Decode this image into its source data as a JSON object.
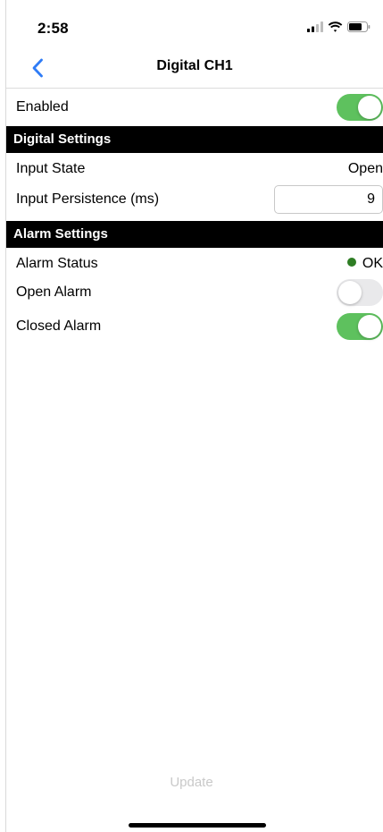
{
  "status_bar": {
    "time": "2:58",
    "icons": [
      "cellular-signal-icon",
      "wifi-icon",
      "battery-icon"
    ]
  },
  "nav": {
    "back_icon": "chevron-left-icon",
    "title": "Digital CH1"
  },
  "enabled_row": {
    "label": "Enabled",
    "toggle_on": true
  },
  "digital_settings": {
    "header": "Digital Settings",
    "input_state_label": "Input State",
    "input_state_value": "Open",
    "persistence_label": "Input Persistence (ms)",
    "persistence_value": "9"
  },
  "alarm_settings": {
    "header": "Alarm Settings",
    "alarm_status_label": "Alarm Status",
    "alarm_status_value": "OK",
    "open_alarm_label": "Open Alarm",
    "open_alarm_on": false,
    "closed_alarm_label": "Closed Alarm",
    "closed_alarm_on": true
  },
  "footer": {
    "update_label": "Update"
  },
  "colors": {
    "toggle_on": "#5ec15e",
    "toggle_off": "#e9e9eb",
    "accent_blue": "#2f7cf6",
    "status_ok": "#2e7d24",
    "section_header_bg": "#000000",
    "update_disabled": "#c9c9c9"
  }
}
